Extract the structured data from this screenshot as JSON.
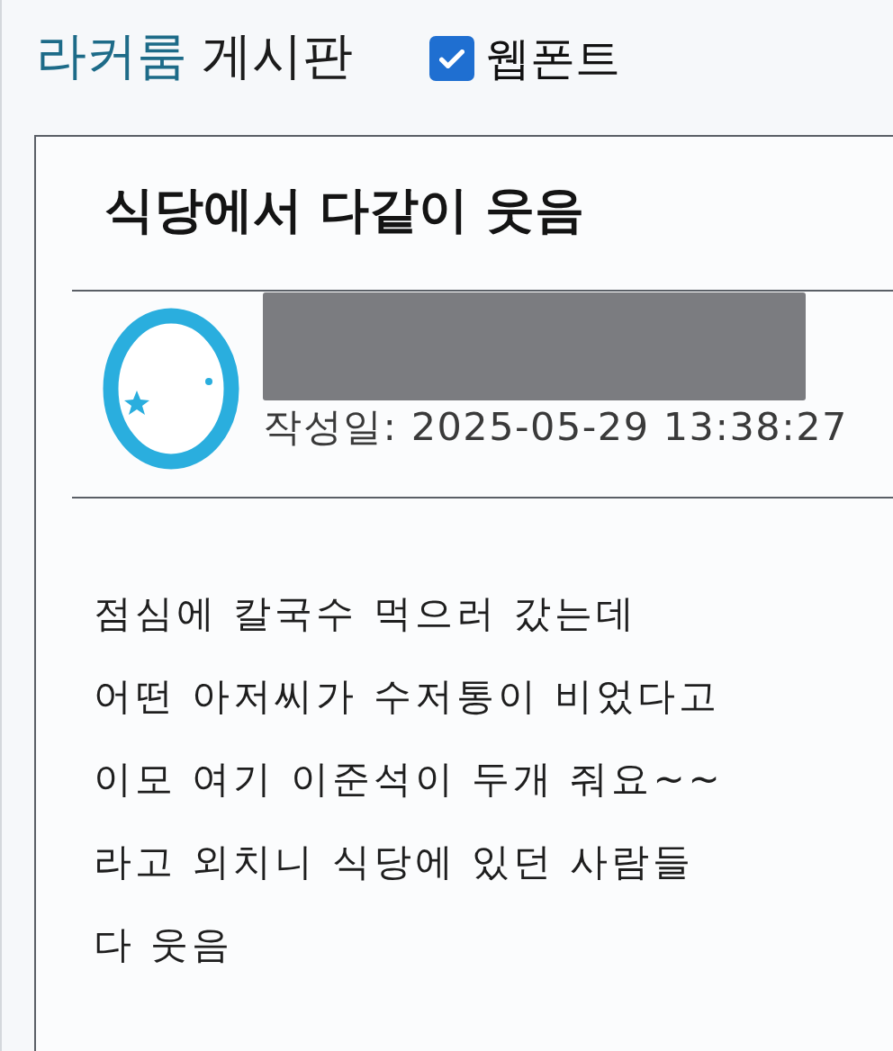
{
  "header": {
    "board_name": "라커룸",
    "board_suffix": "게시판",
    "webfont": {
      "label": "웹폰트",
      "checked": true
    }
  },
  "post": {
    "title": "식당에서 다같이 웃음",
    "author": {
      "name_redacted": true
    },
    "date": "작성일: 2025-05-29 13:38:27",
    "body": [
      "점심에 칼국수 먹으러 갔는데",
      "어떤 아저씨가 수저통이 비었다고",
      "이모 여기 이준석이 두개 줘요~~",
      "라고 외치니 식당에 있던 사람들",
      "다 웃음"
    ]
  }
}
